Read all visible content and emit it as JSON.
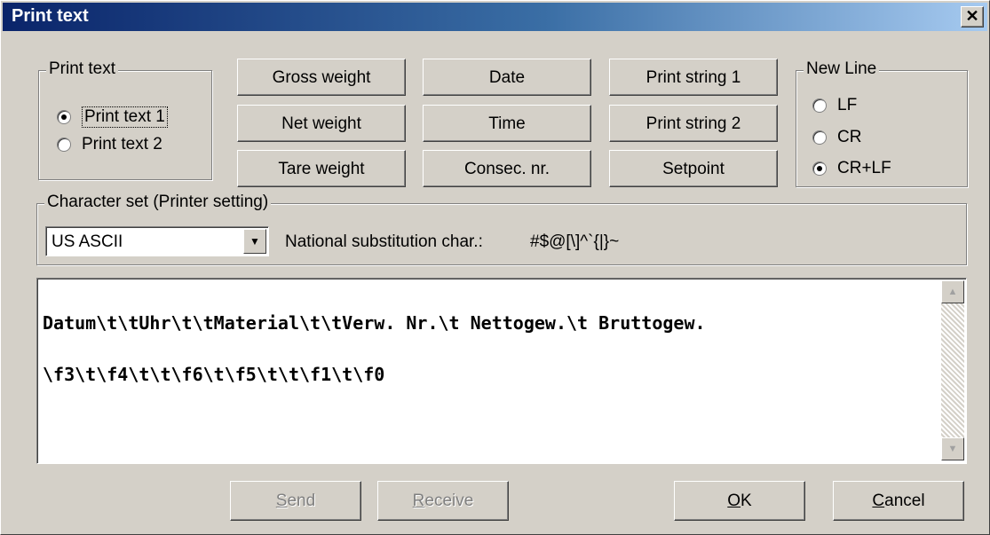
{
  "window": {
    "title": "Print text",
    "close_glyph": "✕"
  },
  "print_text_group": {
    "label": "Print text",
    "options": [
      {
        "label": "Print text 1",
        "checked": true
      },
      {
        "label": "Print text 2",
        "checked": false
      }
    ]
  },
  "field_buttons": {
    "gross_weight": "Gross weight",
    "net_weight": "Net weight",
    "tare_weight": "Tare weight",
    "date": "Date",
    "time": "Time",
    "consec_nr": "Consec. nr.",
    "print_string_1": "Print string 1",
    "print_string_2": "Print string 2",
    "setpoint": "Setpoint"
  },
  "new_line_group": {
    "label": "New Line",
    "options": [
      {
        "label": "LF",
        "checked": false
      },
      {
        "label": "CR",
        "checked": false
      },
      {
        "label": "CR+LF",
        "checked": true
      }
    ]
  },
  "charset_group": {
    "label": "Character set (Printer setting)",
    "selected": "US ASCII",
    "national_label": "National substitution char.:",
    "national_value": "#$@[\\]^`{|}~"
  },
  "editor": {
    "lines": [
      "Datum\\t\\tUhr\\t\\tMaterial\\t\\tVerw. Nr.\\t Nettogew.\\t Bruttogew.",
      "\\f3\\t\\f4\\t\\t\\f6\\t\\f5\\t\\t\\f1\\t\\f0"
    ]
  },
  "footer": {
    "send": {
      "prefix": "",
      "accel": "S",
      "rest": "end"
    },
    "receive": {
      "prefix": "",
      "accel": "R",
      "rest": "eceive"
    },
    "ok": {
      "prefix": "",
      "accel": "O",
      "rest": "K"
    },
    "cancel": {
      "prefix": "",
      "accel": "C",
      "rest": "ancel"
    }
  }
}
